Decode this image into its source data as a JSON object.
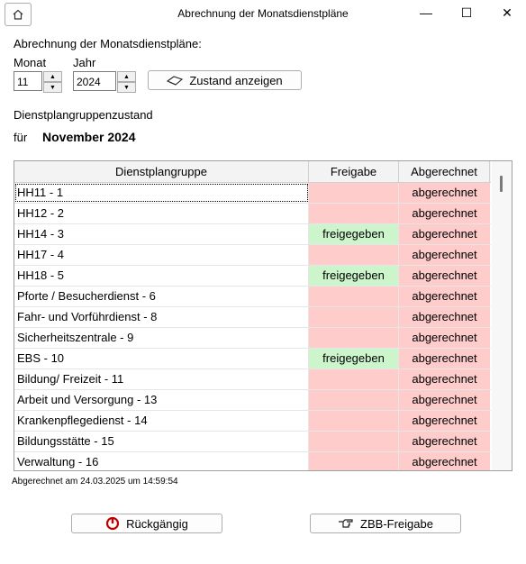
{
  "window": {
    "title": "Abrechnung der Monatsdienstpläne",
    "min": "—",
    "max": "☐",
    "close": "✕"
  },
  "form": {
    "heading": "Abrechnung der Monatsdienstpläne:",
    "month_label": "Monat",
    "year_label": "Jahr",
    "month_value": "11",
    "year_value": "2024",
    "show_button": "Zustand anzeigen",
    "group_state_label": "Dienstplangruppenzustand",
    "for_label": "für",
    "period": "November 2024"
  },
  "table": {
    "columns": [
      "Dienstplangruppe",
      "Freigabe",
      "Abgerechnet"
    ],
    "rows": [
      {
        "group": "HH11 - 1",
        "release": "",
        "billed": "abgerechnet"
      },
      {
        "group": "HH12 - 2",
        "release": "",
        "billed": "abgerechnet"
      },
      {
        "group": "HH14  - 3",
        "release": "freigegeben",
        "billed": "abgerechnet"
      },
      {
        "group": "HH17 - 4",
        "release": "",
        "billed": "abgerechnet"
      },
      {
        "group": "HH18 - 5",
        "release": "freigegeben",
        "billed": "abgerechnet"
      },
      {
        "group": "Pforte / Besucherdienst - 6",
        "release": "",
        "billed": "abgerechnet"
      },
      {
        "group": "Fahr- und Vorführdienst - 8",
        "release": "",
        "billed": "abgerechnet"
      },
      {
        "group": "Sicherheitszentrale - 9",
        "release": "",
        "billed": "abgerechnet"
      },
      {
        "group": "EBS - 10",
        "release": "freigegeben",
        "billed": "abgerechnet"
      },
      {
        "group": "Bildung/ Freizeit - 11",
        "release": "",
        "billed": "abgerechnet"
      },
      {
        "group": "Arbeit und Versorgung  - 13",
        "release": "",
        "billed": "abgerechnet"
      },
      {
        "group": "Krankenpflegedienst - 14",
        "release": "",
        "billed": "abgerechnet"
      },
      {
        "group": "Bildungsstätte - 15",
        "release": "",
        "billed": "abgerechnet"
      },
      {
        "group": "Verwaltung - 16",
        "release": "",
        "billed": "abgerechnet"
      }
    ]
  },
  "status_text": "Abgerechnet am 24.03.2025 um 14:59:54",
  "buttons": {
    "undo": "Rückgängig",
    "release": "ZBB-Freigabe"
  },
  "colors": {
    "released_bg": "#ccf5cc",
    "not_released_bg": "#ffcccc",
    "billed_bg": "#ffcccc"
  }
}
